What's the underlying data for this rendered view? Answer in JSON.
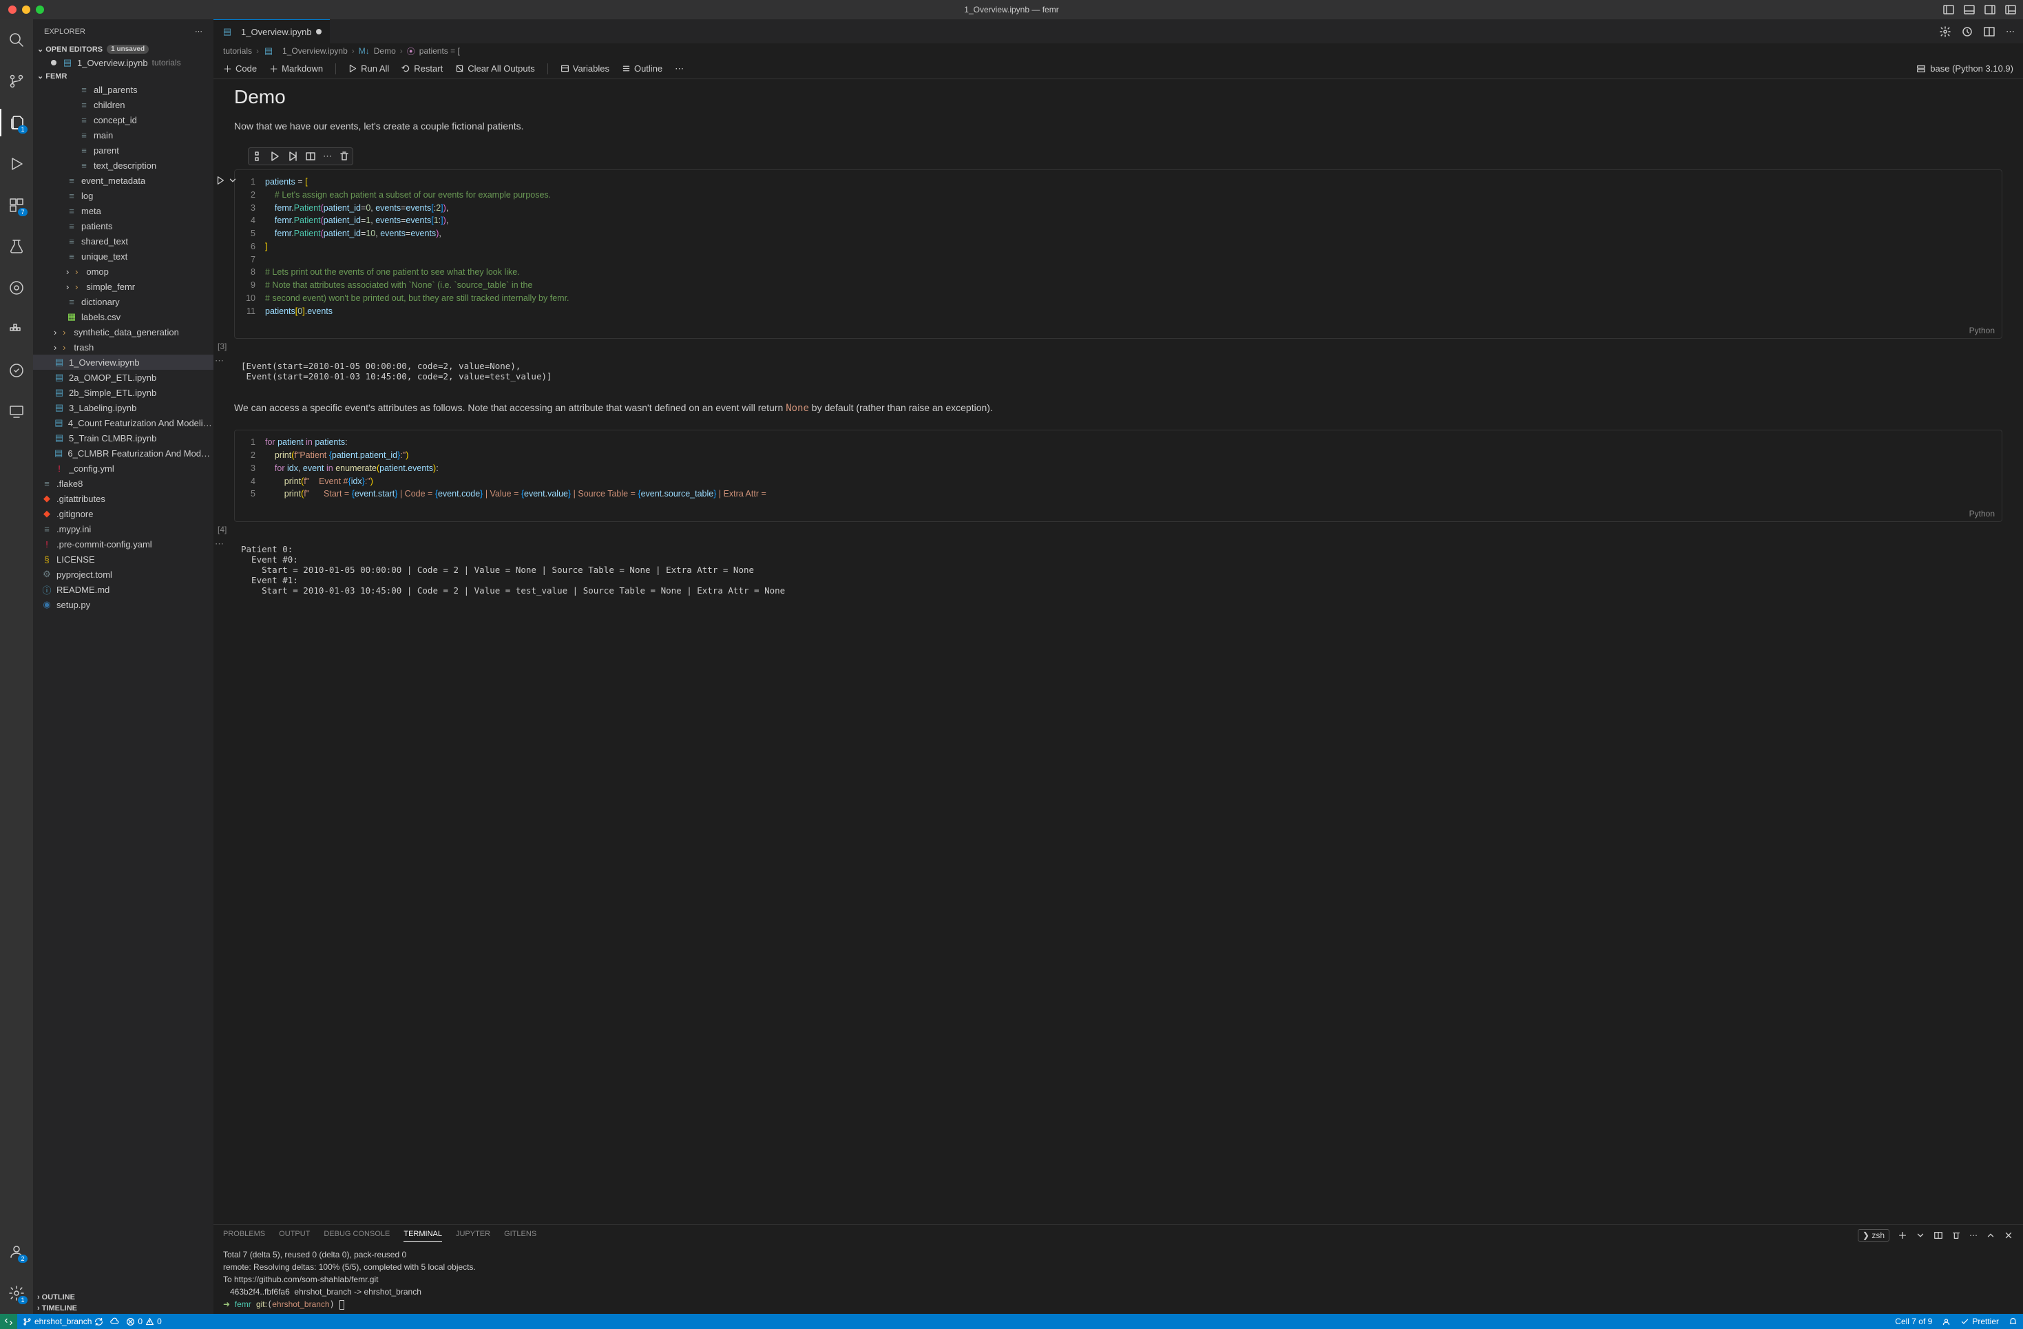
{
  "titlebar": {
    "title": "1_Overview.ipynb — femr"
  },
  "sidebar": {
    "title": "EXPLORER",
    "open_editors_label": "OPEN EDITORS",
    "unsaved_badge": "1 unsaved",
    "open_editor_file": "1_Overview.ipynb",
    "open_editor_hint": "tutorials",
    "project_name": "FEMR",
    "outline_label": "OUTLINE",
    "timeline_label": "TIMELINE",
    "tree": [
      {
        "name": "all_parents",
        "indent": 3,
        "type": "file"
      },
      {
        "name": "children",
        "indent": 3,
        "type": "file"
      },
      {
        "name": "concept_id",
        "indent": 3,
        "type": "file"
      },
      {
        "name": "main",
        "indent": 3,
        "type": "file"
      },
      {
        "name": "parent",
        "indent": 3,
        "type": "file"
      },
      {
        "name": "text_description",
        "indent": 3,
        "type": "file"
      },
      {
        "name": "event_metadata",
        "indent": 2,
        "type": "file"
      },
      {
        "name": "log",
        "indent": 2,
        "type": "file"
      },
      {
        "name": "meta",
        "indent": 2,
        "type": "file"
      },
      {
        "name": "patients",
        "indent": 2,
        "type": "file"
      },
      {
        "name": "shared_text",
        "indent": 2,
        "type": "file"
      },
      {
        "name": "unique_text",
        "indent": 2,
        "type": "file"
      },
      {
        "name": "omop",
        "indent": 2,
        "type": "folder"
      },
      {
        "name": "simple_femr",
        "indent": 2,
        "type": "folder"
      },
      {
        "name": "dictionary",
        "indent": 2,
        "type": "file"
      },
      {
        "name": "labels.csv",
        "indent": 2,
        "type": "csv"
      },
      {
        "name": "synthetic_data_generation",
        "indent": 1,
        "type": "folder"
      },
      {
        "name": "trash",
        "indent": 1,
        "type": "folder"
      },
      {
        "name": "1_Overview.ipynb",
        "indent": 1,
        "type": "notebook",
        "selected": true
      },
      {
        "name": "2a_OMOP_ETL.ipynb",
        "indent": 1,
        "type": "notebook"
      },
      {
        "name": "2b_Simple_ETL.ipynb",
        "indent": 1,
        "type": "notebook"
      },
      {
        "name": "3_Labeling.ipynb",
        "indent": 1,
        "type": "notebook"
      },
      {
        "name": "4_Count Featurization And Modeling.i...",
        "indent": 1,
        "type": "notebook"
      },
      {
        "name": "5_Train CLMBR.ipynb",
        "indent": 1,
        "type": "notebook"
      },
      {
        "name": "6_CLMBR Featurization And Modeling....",
        "indent": 1,
        "type": "notebook"
      },
      {
        "name": "_config.yml",
        "indent": 1,
        "type": "yaml"
      },
      {
        "name": ".flake8",
        "indent": 0,
        "type": "file"
      },
      {
        "name": ".gitattributes",
        "indent": 0,
        "type": "git"
      },
      {
        "name": ".gitignore",
        "indent": 0,
        "type": "git"
      },
      {
        "name": ".mypy.ini",
        "indent": 0,
        "type": "file"
      },
      {
        "name": ".pre-commit-config.yaml",
        "indent": 0,
        "type": "yaml"
      },
      {
        "name": "LICENSE",
        "indent": 0,
        "type": "license"
      },
      {
        "name": "pyproject.toml",
        "indent": 0,
        "type": "toml"
      },
      {
        "name": "README.md",
        "indent": 0,
        "type": "md"
      },
      {
        "name": "setup.py",
        "indent": 0,
        "type": "python"
      }
    ]
  },
  "tab": {
    "label": "1_Overview.ipynb"
  },
  "breadcrumbs": [
    "tutorials",
    "1_Overview.ipynb",
    "Demo",
    "patients = ["
  ],
  "nb_toolbar": {
    "code": "Code",
    "markdown": "Markdown",
    "run_all": "Run All",
    "restart": "Restart",
    "clear": "Clear All Outputs",
    "variables": "Variables",
    "outline": "Outline",
    "kernel": "base (Python 3.10.9)"
  },
  "notebook": {
    "heading": "Demo",
    "intro": "Now that we have our events, let's create a couple fictional patients.",
    "cell1_exec": "[3]",
    "cell1_lang": "Python",
    "cell1_output": "[Event(start=2010-01-05 00:00:00, code=2, value=None),\n Event(start=2010-01-03 10:45:00, code=2, value=test_value)]",
    "mid_text_a": "We can access a specific event's attributes as follows. Note that accessing an attribute that wasn't defined on an event will return ",
    "mid_text_code": "None",
    "mid_text_b": " by default (rather than raise an exception).",
    "cell2_exec": "[4]",
    "cell2_lang": "Python",
    "cell2_output": "Patient 0:\n  Event #0:\n    Start = 2010-01-05 00:00:00 | Code = 2 | Value = None | Source Table = None | Extra Attr = None\n  Event #1:\n    Start = 2010-01-03 10:45:00 | Code = 2 | Value = test_value | Source Table = None | Extra Attr = None"
  },
  "panel": {
    "tabs": [
      "PROBLEMS",
      "OUTPUT",
      "DEBUG CONSOLE",
      "TERMINAL",
      "JUPYTER",
      "GITLENS"
    ],
    "active_tab": "TERMINAL",
    "shell": "zsh",
    "lines": [
      "Total 7 (delta 5), reused 0 (delta 0), pack-reused 0",
      "remote: Resolving deltas: 100% (5/5), completed with 5 local objects.",
      "To https://github.com/som-shahlab/femr.git",
      "   463b2f4..fbf6fa6  ehrshot_branch -> ehrshot_branch"
    ],
    "prompt_dir": "femr",
    "prompt_git": "git:",
    "prompt_branch": "ehrshot_branch"
  },
  "statusbar": {
    "branch": "ehrshot_branch",
    "errors": "0",
    "warnings": "0",
    "position": "Cell 7 of 9",
    "prettier": "Prettier"
  }
}
